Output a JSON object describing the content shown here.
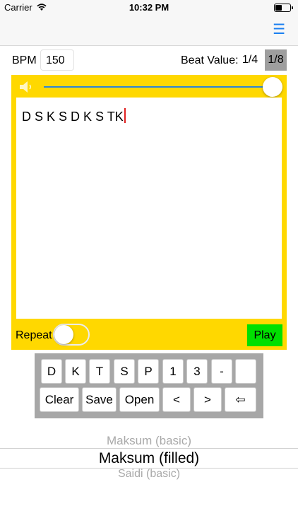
{
  "status": {
    "carrier": "Carrier",
    "time": "10:32 PM"
  },
  "nav": {
    "menu_icon": "☰"
  },
  "bpm": {
    "label": "BPM",
    "value": "150"
  },
  "beat": {
    "label": "Beat Value:",
    "option1": "1/4",
    "option2": "1/8",
    "selected": "1/8"
  },
  "volume": {
    "level": 1.0
  },
  "editor": {
    "text": "D S K S D K S TK"
  },
  "repeat": {
    "label": "Repeat",
    "on": false
  },
  "play": {
    "label": "Play"
  },
  "keyboard": {
    "row1": [
      "D",
      "K",
      "T",
      "S",
      "P",
      "1",
      "3",
      "-",
      ""
    ],
    "row2": [
      "Clear",
      "Save",
      "Open",
      "<",
      ">",
      "⇦"
    ]
  },
  "picker": {
    "items": [
      "Maksum (basic)",
      "Maksum (filled)",
      "Saidi (basic)"
    ],
    "selected": "Maksum (filled)"
  },
  "colors": {
    "accent": "#ffd800",
    "play": "#00e000",
    "slider": "#2f86d4",
    "nav_icon": "#1a7ff0"
  }
}
